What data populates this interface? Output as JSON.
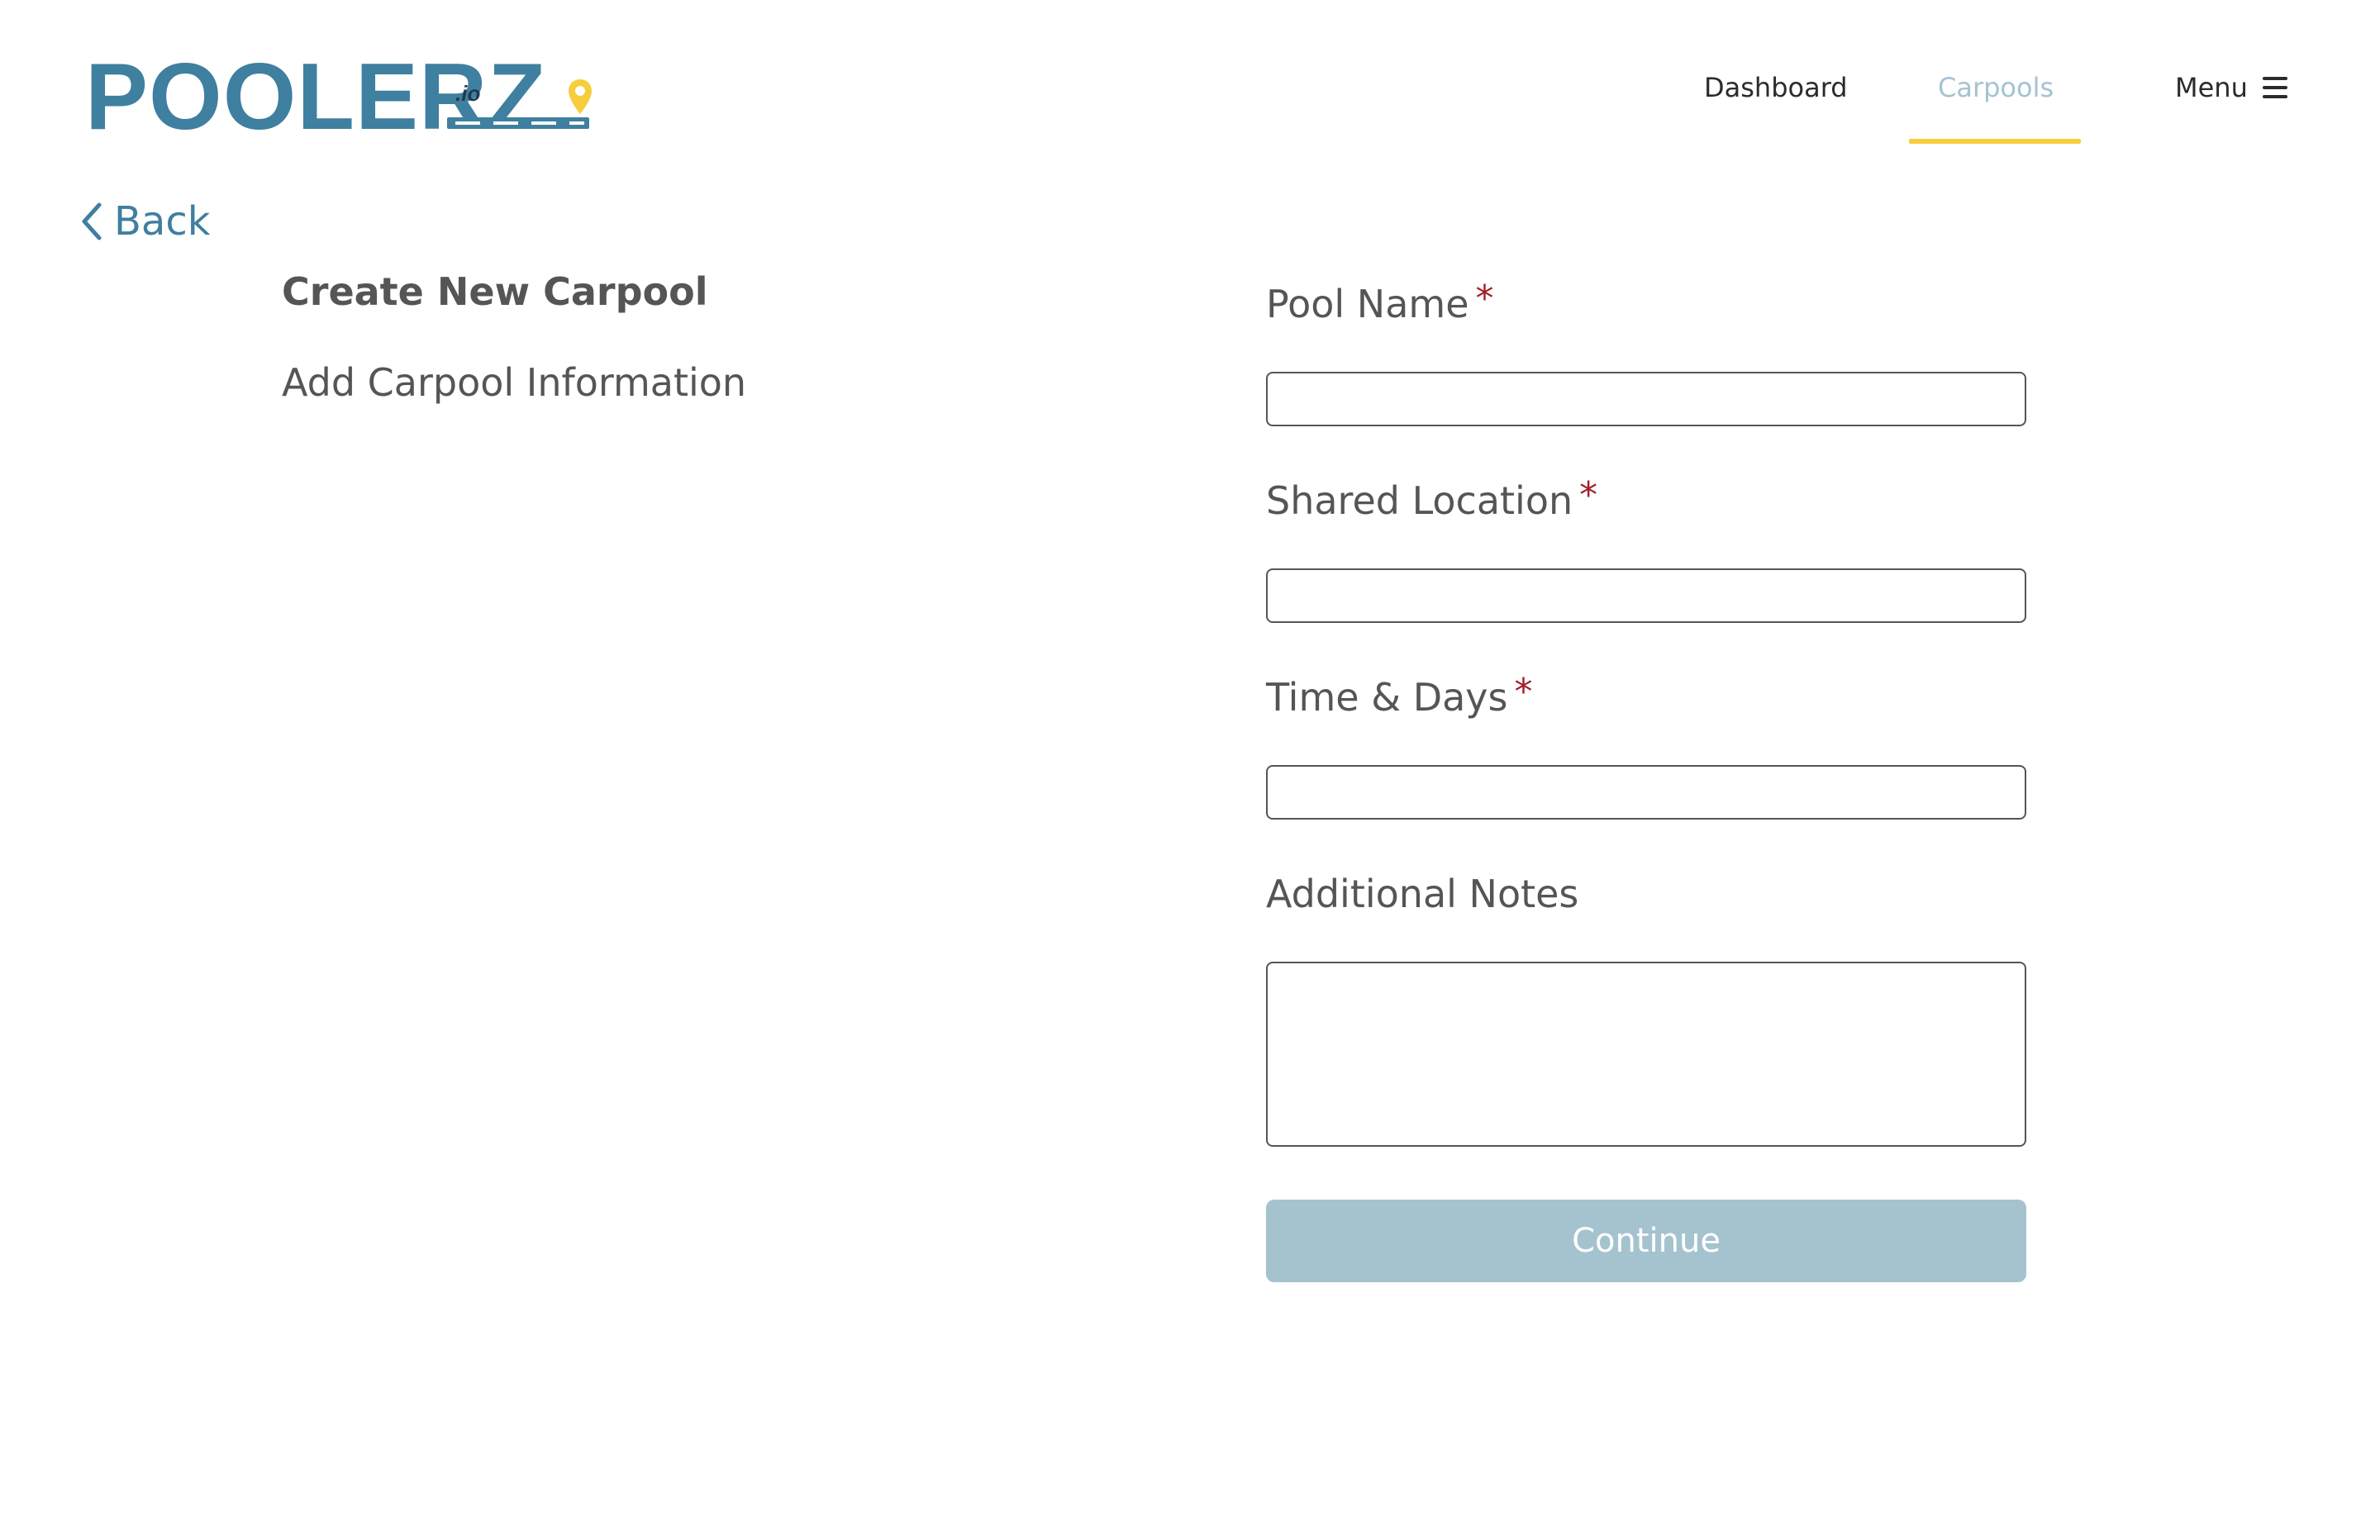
{
  "brand": {
    "logo_text": "POOLERZ",
    "logo_suffix": ".io",
    "primary_color": "#3f7f9f",
    "accent_color": "#f6cd3c"
  },
  "nav": {
    "items": [
      {
        "label": "Dashboard",
        "active": false
      },
      {
        "label": "Carpools",
        "active": true
      },
      {
        "label": "Menu",
        "icon": "hamburger-menu-icon",
        "active": false
      }
    ]
  },
  "back": {
    "label": "Back",
    "icon": "chevron-left-icon"
  },
  "page": {
    "title": "Create New Carpool",
    "subtitle": "Add Carpool Information"
  },
  "form": {
    "fields": [
      {
        "label": "Pool Name",
        "required": true,
        "value": ""
      },
      {
        "label": "Shared Location",
        "required": true,
        "value": ""
      },
      {
        "label": "Time & Days",
        "required": true,
        "value": ""
      },
      {
        "label": "Additional Notes",
        "required": false,
        "value": ""
      }
    ],
    "required_marker": "*",
    "submit_label": "Continue",
    "submit_color": "#a5c3ce"
  }
}
